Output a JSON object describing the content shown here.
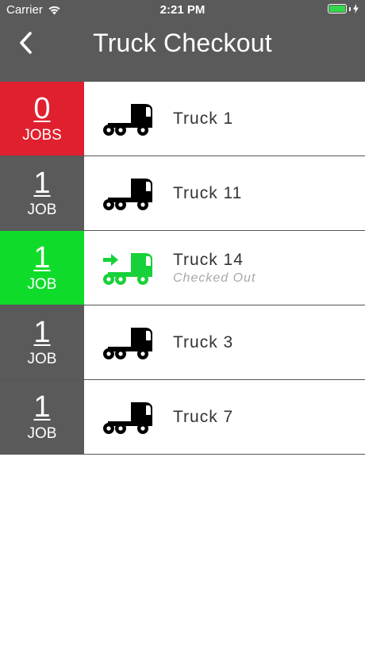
{
  "status_bar": {
    "carrier": "Carrier",
    "time": "2:21 PM"
  },
  "nav": {
    "title": "Truck Checkout"
  },
  "colors": {
    "header": "#5a5a5a",
    "zero_jobs": "#e0202e",
    "has_jobs": "#5a5a5a",
    "checked_out": "#0fdc2a",
    "checked_out_icon": "#18d13a",
    "truck_icon": "#000000"
  },
  "trucks": [
    {
      "name": "Truck 1",
      "count": "0",
      "unit": "JOBS",
      "status": "",
      "state": "zero"
    },
    {
      "name": "Truck 11",
      "count": "1",
      "unit": "JOB",
      "status": "",
      "state": "normal"
    },
    {
      "name": "Truck 14",
      "count": "1",
      "unit": "JOB",
      "status": "Checked Out",
      "state": "checked_out"
    },
    {
      "name": "Truck 3",
      "count": "1",
      "unit": "JOB",
      "status": "",
      "state": "normal"
    },
    {
      "name": "Truck 7",
      "count": "1",
      "unit": "JOB",
      "status": "",
      "state": "normal"
    }
  ]
}
